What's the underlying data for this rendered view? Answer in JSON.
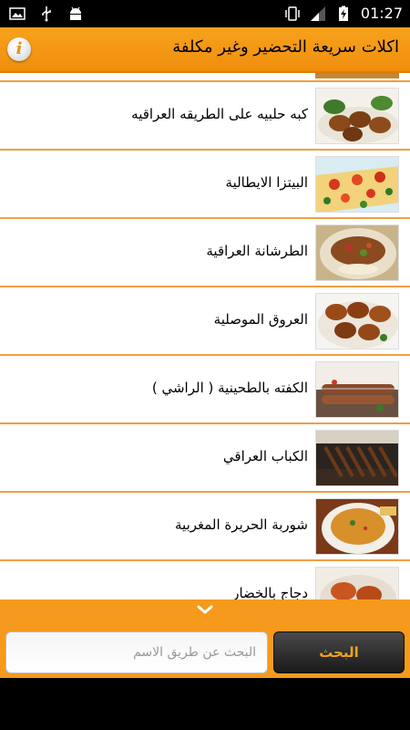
{
  "status_bar": {
    "time": "01:27",
    "icons": [
      "image-icon",
      "usb-icon",
      "android-debug-icon",
      "vibrate-icon",
      "signal-icon",
      "battery-charging-icon"
    ]
  },
  "app_bar": {
    "title": "اكلات سريعة التحضير وغير مكلفة",
    "info_icon": "i"
  },
  "list": {
    "items": [
      {
        "label": "كبه حلبيه على الطريقه العراقيه",
        "image": "kibbeh-photo"
      },
      {
        "label": "البيتزا الايطالية",
        "image": "pizza-photo"
      },
      {
        "label": "الطرشانة العراقية",
        "image": "torshana-photo"
      },
      {
        "label": "العروق الموصلية",
        "image": "uruq-photo"
      },
      {
        "label": "الكفته بالطحينية ( الراشي )",
        "image": "kofta-photo"
      },
      {
        "label": "الكباب العراقي",
        "image": "kebab-photo"
      },
      {
        "label": "شوربة الحريرة المغربية",
        "image": "harira-soup-photo"
      },
      {
        "label": "دجاج بالخضار",
        "image": "chicken-vegetables-photo"
      }
    ]
  },
  "search": {
    "placeholder": "البحث عن طريق الاسم",
    "button_label": "البحث"
  },
  "colors": {
    "accent": "#f59a1c",
    "divider": "#f0a040",
    "button_text": "#f4a21e"
  }
}
